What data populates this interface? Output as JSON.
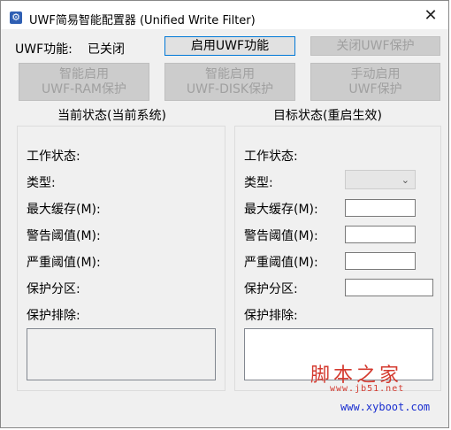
{
  "window": {
    "title": "UWF简易智能配置器    (Unified Write Filter)",
    "icon": "gear-icon",
    "close_glyph": "✕"
  },
  "status": {
    "label": "UWF功能:",
    "value": "已关闭"
  },
  "buttons": {
    "enable_uwf": "启用UWF功能",
    "disable_protection": "关闭UWF保护",
    "smart_ram": "智能启用\nUWF-RAM保护",
    "smart_disk": "智能启用\nUWF-DISK保护",
    "manual_enable": "手动启用\nUWF保护"
  },
  "current": {
    "heading": "当前状态(当前系统)",
    "work_state": "工作状态:",
    "type": "类型:",
    "max_cache": "最大缓存(M):",
    "warn_threshold": "警告阈值(M):",
    "critical_threshold": "严重阈值(M):",
    "protected_volume": "保护分区:",
    "exclusions": "保护排除:"
  },
  "target": {
    "heading": "目标状态(重启生效)",
    "work_state": "工作状态:",
    "type": "类型:",
    "max_cache": "最大缓存(M):",
    "warn_threshold": "警告阈值(M):",
    "critical_threshold": "严重阈值(M):",
    "protected_volume": "保护分区:",
    "exclusions": "保护排除:",
    "type_select_value": "",
    "max_cache_value": "",
    "warn_value": "",
    "critical_value": "",
    "volume_value": ""
  },
  "watermark": {
    "cn": "脚本之家",
    "url1": "www.jb51.net",
    "url2": "www.xyboot.com",
    "color_red": "#d43a2f",
    "color_blue": "#1a2fd0"
  }
}
